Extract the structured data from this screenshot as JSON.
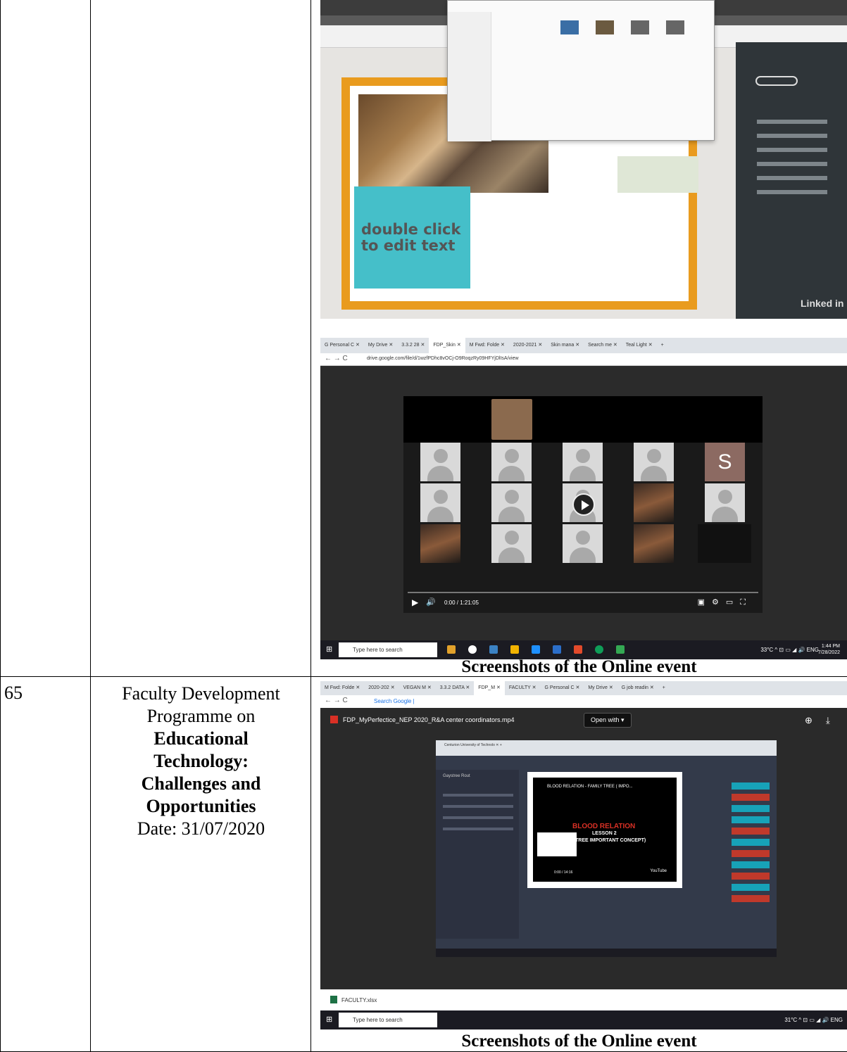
{
  "rows": [
    {
      "serial": "",
      "title_lines": [],
      "caption": "Screenshots of the Online event"
    },
    {
      "serial": "65",
      "title_line1": "Faculty Development",
      "title_line2": "Programme on",
      "title_bold1": "Educational",
      "title_bold2": "Technology:",
      "title_bold3": "Challenges and",
      "title_bold4": "Opportunities",
      "date": "Date: 31/07/2020",
      "caption": "Screenshots of the Online event"
    }
  ],
  "shot1": {
    "canvas_text_line1": "double click",
    "canvas_text_line2": "to edit text",
    "brand": "Linked in"
  },
  "shot2": {
    "tabs": [
      "G Personal C ✕",
      "My Drive ✕",
      "3.3.2 28 ✕",
      "FDP_Skin ✕",
      "M Fwd: Folde ✕",
      "2020-2021 ✕",
      "Skin mana ✕",
      "Search me ✕",
      "Teal Light ✕",
      "+"
    ],
    "url": "drive.google.com/file/d/1wzfPDhc8vOCj-O9RoqzRy09HFYjDlIsA/view",
    "participant_initial": "S",
    "time": "0:00 / 1:21:05",
    "search_placeholder": "Type here to search",
    "weather": "33°C",
    "lang": "ENG",
    "clock_time": "1:44 PM",
    "clock_date": "7/28/2022"
  },
  "shot3": {
    "tabs": [
      "M Fwd: Folde ✕",
      "2020-202 ✕",
      "VEGAN M ✕",
      "3.3.2 DATA ✕",
      "FDP_M ✕",
      "FACULTY ✕",
      "G Personal C ✕",
      "My Drive ✕",
      "G job readin ✕",
      "+"
    ],
    "omnibox": "Search Google |",
    "file_name": "FDP_MyPerfectice_NEP 2020_R&A center coordinators.mp4",
    "open_with": "Open with ▾",
    "inner_tab": "Centurion University of Technolo  ✕   +",
    "profile_name": "Gaystree Rout",
    "video_title": "BLOOD RELATION - FAMILY TREE ( IMPO...",
    "video_heading": "BLOOD RELATION",
    "video_line2": "LESSON 2",
    "video_line3": "TREE IMPORTANT CONCEPT)",
    "video_time": "0:00 / 14:16",
    "youtube": "YouTube",
    "download_file": "FACULTY.xlsx",
    "search_placeholder": "Type here to search",
    "weather": "31°C",
    "lang": "ENG"
  }
}
